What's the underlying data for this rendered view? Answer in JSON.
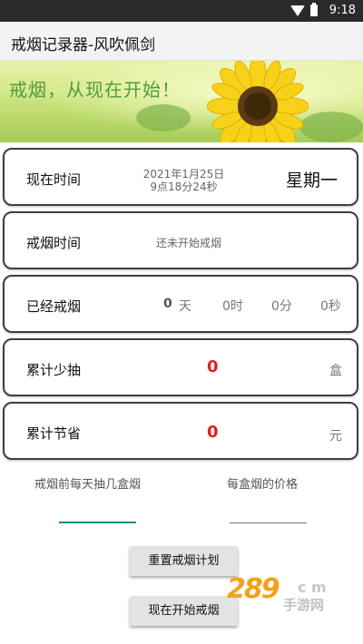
{
  "statusbar": {
    "time": "9:18",
    "icons": [
      "wifi-icon",
      "battery-icon"
    ]
  },
  "appbar": {
    "title": "戒烟记录器-风吹佩剑"
  },
  "banner": {
    "slogan": "戒烟，从现在开始！"
  },
  "cards": {
    "now": {
      "label": "现在时间",
      "date": "2021年1月25日",
      "time": "9点18分24秒",
      "weekday": "星期一"
    },
    "quit_time": {
      "label": "戒烟时间",
      "value": "还未开始戒烟"
    },
    "elapsed": {
      "label": "已经戒烟",
      "days_value": "0",
      "days_unit": "天",
      "hours": "0时",
      "minutes": "0分",
      "seconds": "0秒"
    },
    "less_smoked": {
      "label": "累计少抽",
      "value": "0",
      "unit": "盒"
    },
    "saved": {
      "label": "累计节省",
      "value": "0",
      "unit": "元"
    }
  },
  "form": {
    "packs_label": "戒烟前每天抽几盒烟",
    "price_label": "每盒烟的价格",
    "packs_value": "",
    "price_value": ""
  },
  "buttons": {
    "reset": "重置戒烟计划",
    "start": "现在开始戒烟"
  },
  "watermark": {
    "text": "289",
    "com": "c m",
    "sub": "手游网"
  },
  "colors": {
    "accent_underline": "#1e8a8a",
    "value_red": "#e02020",
    "slogan_green": "#4d9c3e"
  }
}
